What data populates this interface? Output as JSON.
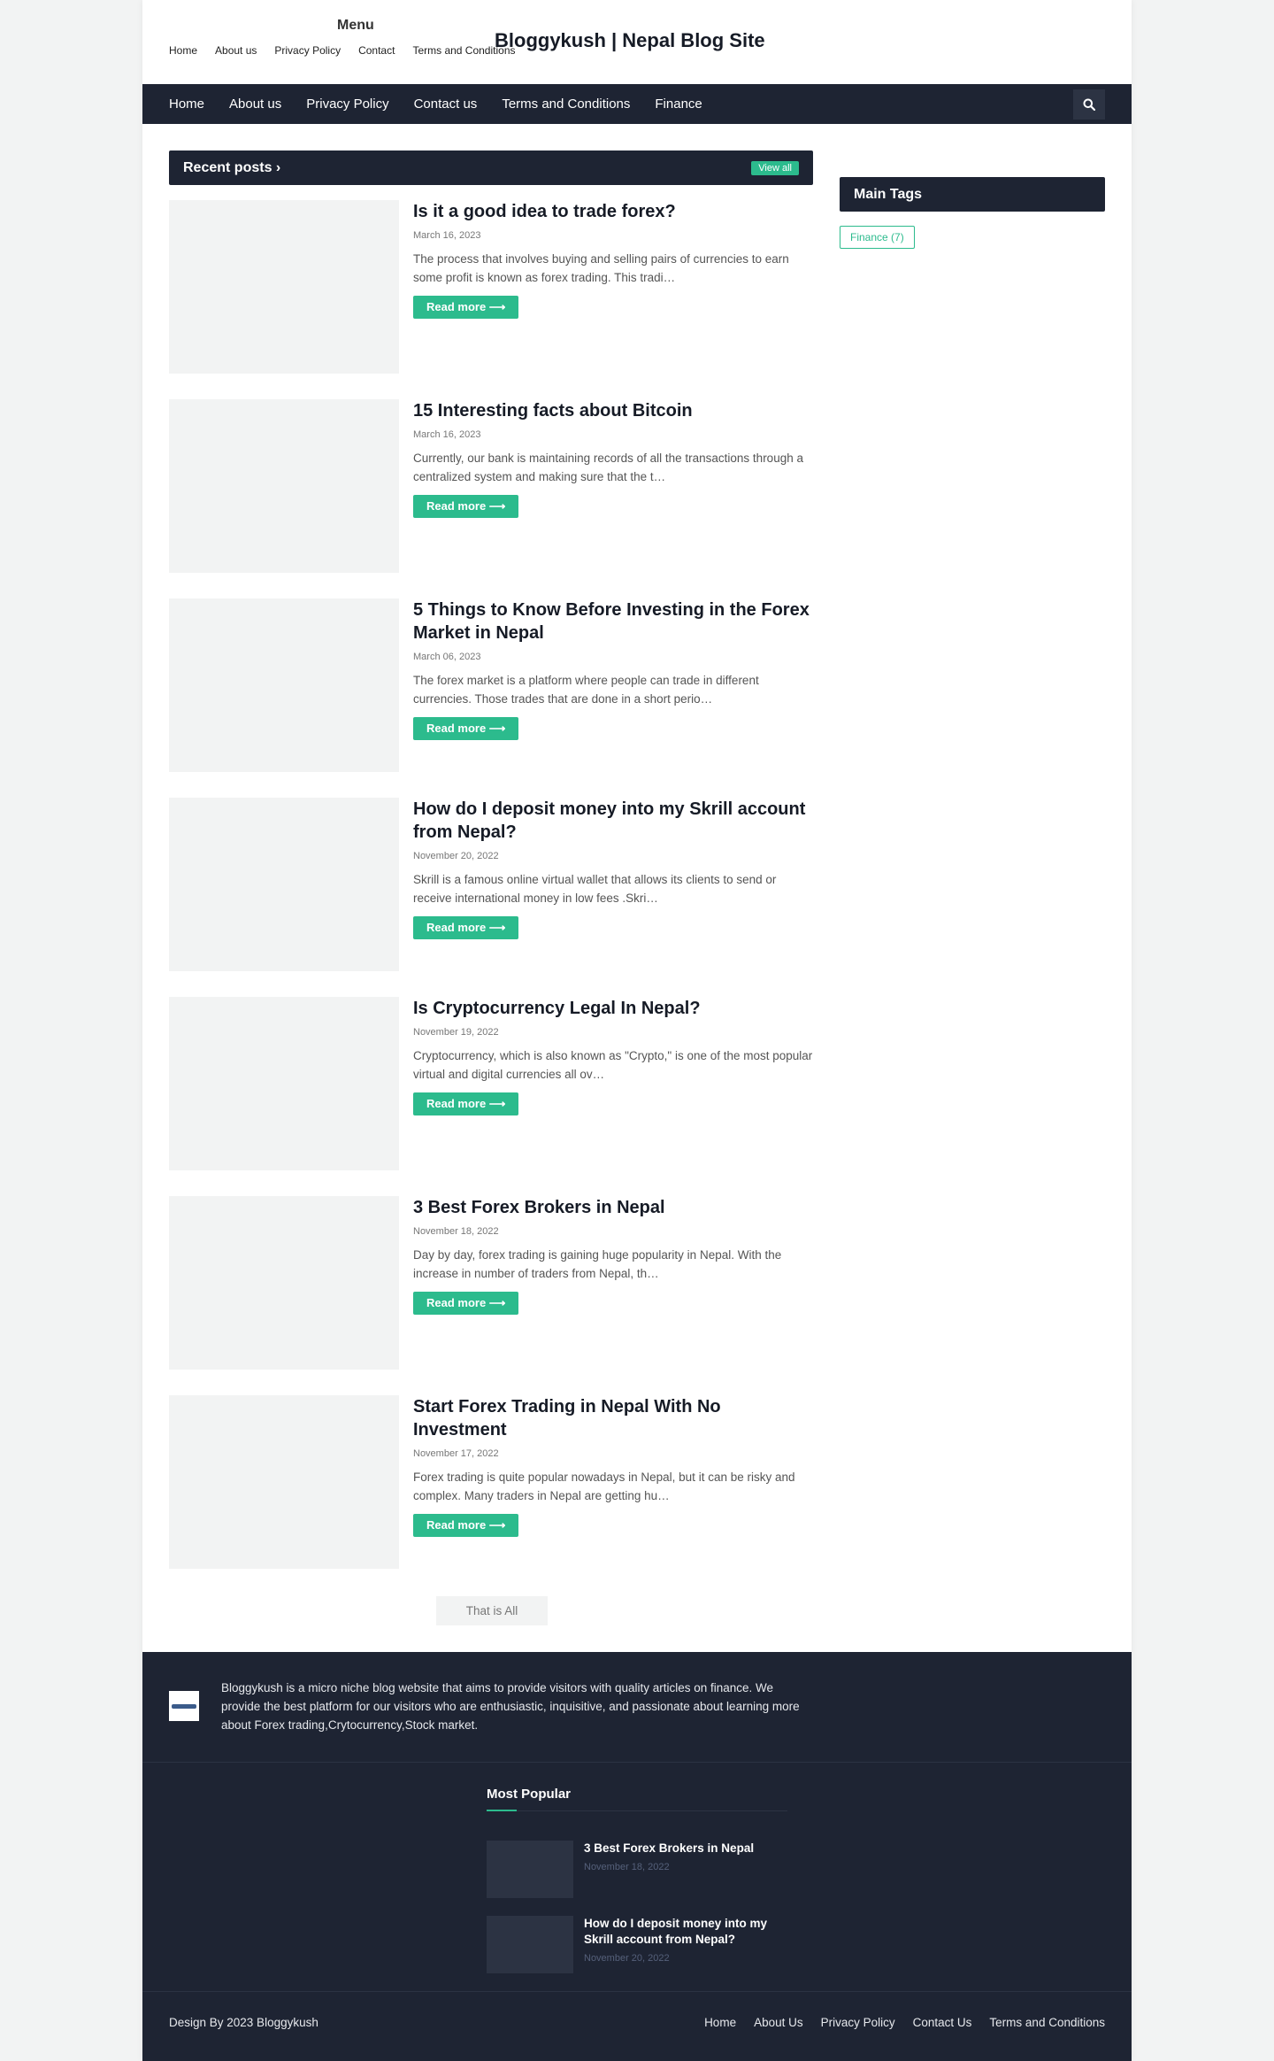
{
  "header": {
    "menu_title": "Menu",
    "top_links": [
      "Home",
      "About us",
      "Privacy Policy",
      "Contact",
      "Terms and Conditions"
    ],
    "site_title": "Bloggykush | Nepal Blog Site"
  },
  "nav": {
    "items": [
      "Home",
      "About us",
      "Privacy Policy",
      "Contact us",
      "Terms and Conditions",
      "Finance"
    ],
    "search_icon": "search-icon"
  },
  "recent": {
    "heading": "Recent posts ›",
    "view_all": "View all",
    "read_more": "Read more ⟶",
    "posts": [
      {
        "title": "Is it a good idea to trade forex?",
        "date": "March 16, 2023",
        "excerpt": "The process that involves buying and selling pairs of currencies to earn some profit is known as forex trading. This tradi…"
      },
      {
        "title": "15 Interesting facts about Bitcoin",
        "date": "March 16, 2023",
        "excerpt": "Currently, our bank is maintaining records of all the transactions through a centralized system and making sure that the t…"
      },
      {
        "title": "5 Things to Know Before Investing in the Forex Market in Nepal",
        "date": "March 06, 2023",
        "excerpt": "The forex market is a platform where people can trade in different currencies. Those trades that are done in a short perio…"
      },
      {
        "title": "How do I deposit money into my Skrill account from Nepal?",
        "date": "November 20, 2022",
        "excerpt": "Skrill is a famous online virtual wallet that allows its clients to send or receive international money in low fees .Skri…"
      },
      {
        "title": "Is Cryptocurrency Legal In Nepal?",
        "date": "November 19, 2022",
        "excerpt": "Cryptocurrency, which is also known as \"Crypto,\" is one of the most popular virtual and digital currencies all ov…"
      },
      {
        "title": "3 Best Forex Brokers in Nepal",
        "date": "November 18, 2022",
        "excerpt": "Day by day, forex trading is gaining huge popularity in Nepal. With the increase in number of traders from Nepal, th…"
      },
      {
        "title": "Start Forex Trading in Nepal With No Investment",
        "date": "November 17, 2022",
        "excerpt": "Forex trading is quite popular nowadays in Nepal, but it can be risky and complex. Many traders in Nepal are getting hu…"
      }
    ],
    "end_label": "That is All"
  },
  "sidebar": {
    "heading": "Main Tags",
    "tag": "Finance   (7)"
  },
  "footer": {
    "about": "Bloggykush is a micro niche blog website that aims to provide visitors with quality articles on finance. We provide the best platform for our visitors who are enthusiastic, inquisitive, and passionate about learning more about Forex trading,Crytocurrency,Stock market.",
    "popular_heading": "Most Popular",
    "popular": [
      {
        "title": "3 Best Forex Brokers in Nepal",
        "date": "November 18, 2022"
      },
      {
        "title": "How do I deposit money into my Skrill account from Nepal?",
        "date": "November 20, 2022"
      }
    ],
    "credit": "Design By 2023 Bloggykush",
    "links": [
      "Home",
      "About Us",
      "Privacy Policy",
      "Contact Us",
      "Terms and Conditions"
    ]
  },
  "colors": {
    "accent": "#2cbb8d",
    "dark": "#1e2433"
  }
}
